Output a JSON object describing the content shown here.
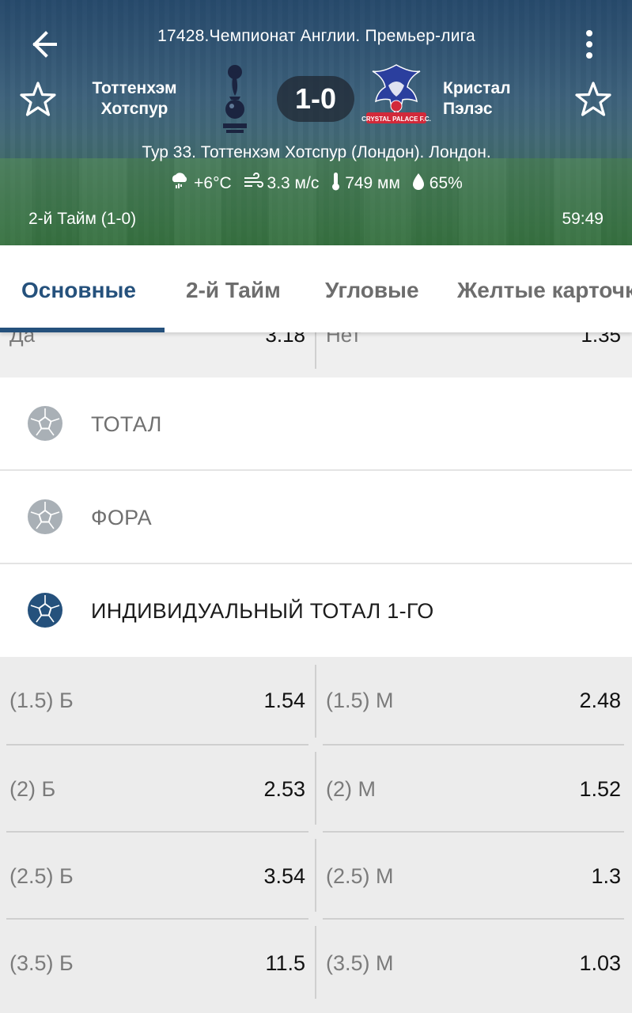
{
  "header": {
    "league": "17428.Чемпионат Англии. Премьер-лига",
    "home_team_line1": "Тоттенхэм",
    "home_team_line2": "Хотспур",
    "away_team_line1": "Кристал",
    "away_team_line2": "Пэлэс",
    "score": "1-0",
    "venue": "Тур 33. Тоттенхэм Хотспур (Лондон). Лондон.",
    "weather": {
      "temperature": "+6°C",
      "wind": "3.3 м/с",
      "pressure": "749 мм",
      "humidity": "65%"
    },
    "period": "2-й  Тайм (1-0)",
    "timer": "59:49",
    "icons": [
      "back-arrow-icon",
      "more-vert-icon",
      "star-outline-icon",
      "cloud-rain-icon",
      "wind-icon",
      "thermometer-icon",
      "droplet-icon"
    ]
  },
  "tabs": [
    {
      "label": "Основные",
      "active": true
    },
    {
      "label": "2-й  Тайм",
      "active": false
    },
    {
      "label": "Угловые",
      "active": false
    },
    {
      "label": "Желтые карточк",
      "active": false
    }
  ],
  "partial_row": {
    "left_label": "Да",
    "left_value": "3.18",
    "right_label": "Нет",
    "right_value": "1.35"
  },
  "sections": [
    {
      "title": "ТОТАЛ",
      "expanded": false
    },
    {
      "title": "ФОРА",
      "expanded": false
    },
    {
      "title": "ИНДИВИДУАЛЬНЫЙ ТОТАЛ 1-ГО",
      "expanded": true
    }
  ],
  "odds_rows": [
    {
      "left_label": "(1.5) Б",
      "left_value": "1.54",
      "right_label": "(1.5) М",
      "right_value": "2.48"
    },
    {
      "left_label": "(2) Б",
      "left_value": "2.53",
      "right_label": "(2) М",
      "right_value": "1.52"
    },
    {
      "left_label": "(2.5) Б",
      "left_value": "3.54",
      "right_label": "(2.5) М",
      "right_value": "1.3"
    },
    {
      "left_label": "(3.5) Б",
      "left_value": "11.5",
      "right_label": "(3.5) М",
      "right_value": "1.03"
    }
  ],
  "colors": {
    "accent": "#25517c",
    "inactive_ball": "#a9b0b6",
    "active_ball": "#25517c",
    "odds_background": "#ececec"
  }
}
